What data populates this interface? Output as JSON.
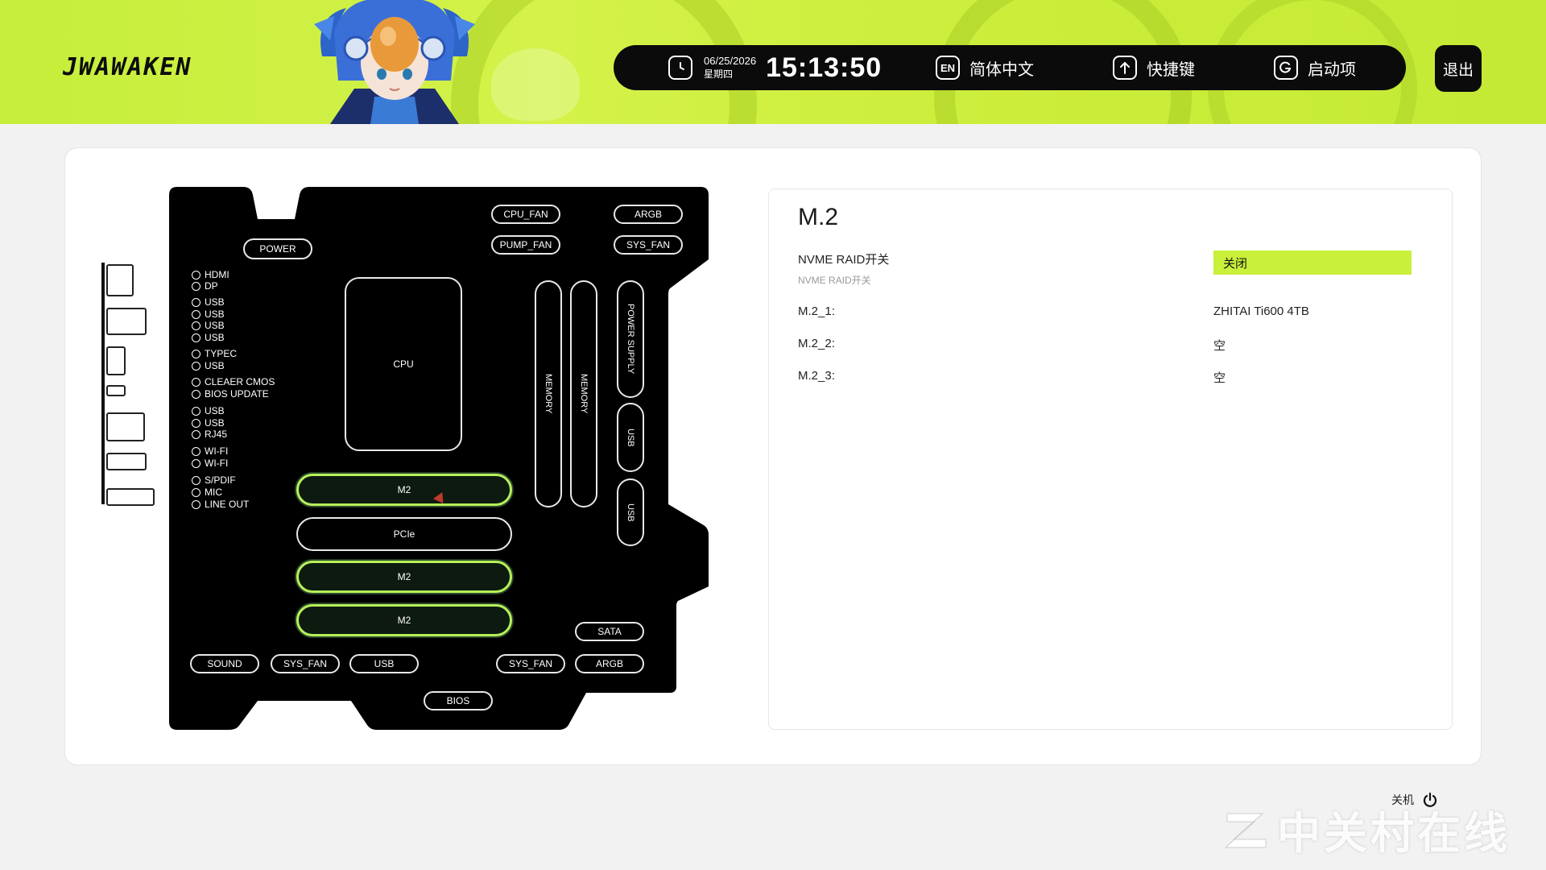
{
  "header": {
    "logo": "JWAWAKEN",
    "date": "06/25/2026",
    "weekday": "星期四",
    "time": "15:13:50",
    "lang_icon": "EN",
    "lang_label": "简体中文",
    "shortcut_label": "快捷键",
    "boot_label": "启动项",
    "exit_label": "退出",
    "icons": [
      "clock-icon",
      "language-icon",
      "shortcut-icon",
      "boot-icon"
    ]
  },
  "board": {
    "top_connectors": [
      "CPU_FAN",
      "ARGB",
      "PUMP_FAN",
      "SYS_FAN"
    ],
    "power": "POWER",
    "cpu": "CPU",
    "memory": [
      "MEMORY",
      "MEMORY"
    ],
    "power_supply": "POWER SUPPLY",
    "usb_vertical": [
      "USB",
      "USB"
    ],
    "slots": [
      "M2",
      "PCIe",
      "M2",
      "M2"
    ],
    "sata": "SATA",
    "bottom_connectors": [
      "SOUND",
      "SYS_FAN",
      "USB",
      "SYS_FAN",
      "ARGB"
    ],
    "bios": "BIOS",
    "io_ports": [
      "HDMI",
      "DP",
      "USB",
      "USB",
      "USB",
      "USB",
      "TYPEC",
      "USB",
      "CLEAER CMOS",
      "BIOS UPDATE",
      "USB",
      "USB",
      "RJ45",
      "WI-FI",
      "WI-FI",
      "S/PDIF",
      "MIC",
      "LINE OUT"
    ]
  },
  "detail": {
    "title": "M.2",
    "raid_label": "NVME RAID开关",
    "raid_sub": "NVME RAID开关",
    "raid_value": "关闭",
    "rows": [
      {
        "label": "M.2_1:",
        "value": "ZHITAI Ti600 4TB"
      },
      {
        "label": "M.2_2:",
        "value": "空"
      },
      {
        "label": "M.2_3:",
        "value": "空"
      }
    ]
  },
  "footer": {
    "shutdown_label": "关机",
    "watermark": "中关村在线"
  },
  "colors": {
    "accent": "#c9f03a",
    "dark": "#0b0b0b",
    "m2_border": "#b7f05a"
  }
}
